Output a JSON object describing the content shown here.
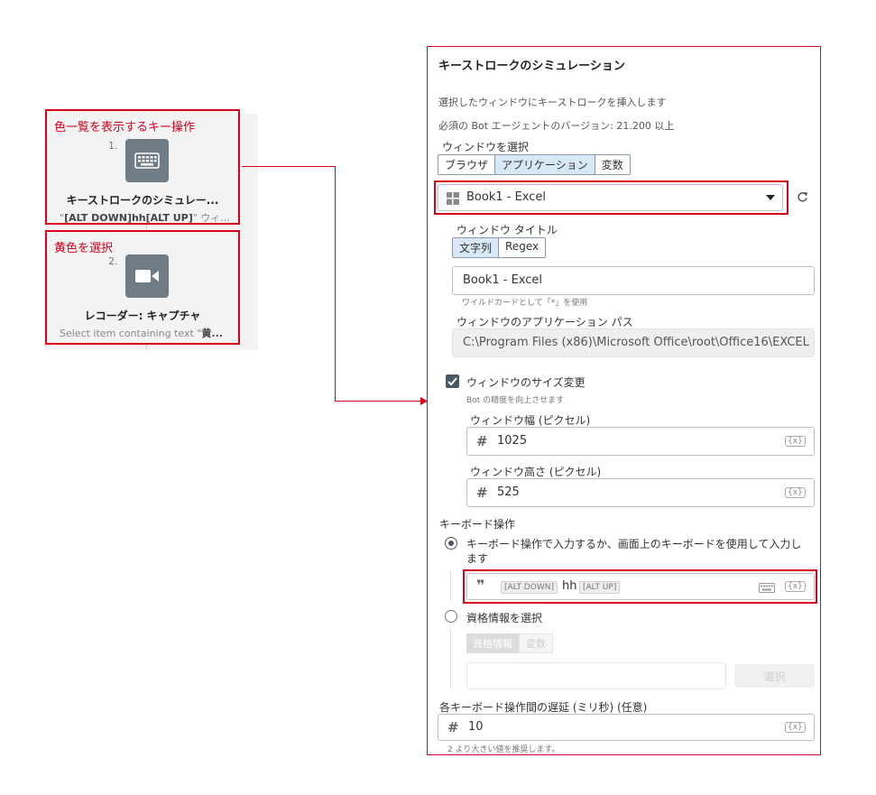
{
  "flow": {
    "step1": {
      "annotation": "色一覧を表示するキー操作",
      "number": "1.",
      "icon": "keyboard-icon",
      "title": "キーストロークのシミュレー...",
      "subtitle_prefix": "\"",
      "subtitle_bold": "[ALT DOWN]hh[ALT UP]",
      "subtitle_rest": "\" ウィ..."
    },
    "step2": {
      "annotation": "黄色を選択",
      "number": "2.",
      "icon": "video-camera-icon",
      "title": "レコーダー: キャプチャ",
      "subtitle_prefix": "Select item containing text \"",
      "subtitle_bold": "黄..."
    }
  },
  "panel": {
    "title": "キーストロークのシミュレーション",
    "description": "選択したウィンドウにキーストロークを挿入します",
    "version_note": "必須の Bot エージェントのバージョン: 21.200 以上",
    "window_select_label": "ウィンドウを選択",
    "window_tabs": [
      "ブラウザ",
      "アプリケーション",
      "変数"
    ],
    "window_tab_active": 1,
    "window_dropdown_value": "Book1 - Excel",
    "window_title_label": "ウィンドウ タイトル",
    "title_mode_tabs": [
      "文字列",
      "Regex"
    ],
    "title_value": "Book1 - Excel",
    "wildcard_hint": "ワイルドカードとして「*」を使用",
    "app_path_label": "ウィンドウのアプリケーション パス",
    "app_path_value": "C:\\Program Files (x86)\\Microsoft Office\\root\\Office16\\EXCEL",
    "resize_label": "ウィンドウのサイズ変更",
    "resize_hint": "Bot の精度を向上させます",
    "width_label": "ウィンドウ幅 (ピクセル)",
    "width_value": "1025",
    "height_label": "ウィンドウ高さ (ピクセル)",
    "height_value": "525",
    "keyboard_section_label": "キーボード操作",
    "option1_label": "キーボード操作で入力するか、画面上のキーボードを使用して入力します",
    "keystroke_chip1": "[ALT DOWN]",
    "keystroke_text": "hh",
    "keystroke_chip2": "[ALT UP]",
    "option2_label": "資格情報を選択",
    "cred_tabs": [
      "資格情報",
      "変数"
    ],
    "cred_button": "選択",
    "delay_label": "各キーボード操作間の遅延 (ミリ秒) (任意)",
    "delay_value": "10",
    "delay_hint": "2 より大きい値を推奨します。",
    "var_badge": "{x}"
  },
  "colors": {
    "annotation_red": "#d9001b",
    "tab_active_bg": "#d9e8f6",
    "icon_gray": "#707c85"
  }
}
